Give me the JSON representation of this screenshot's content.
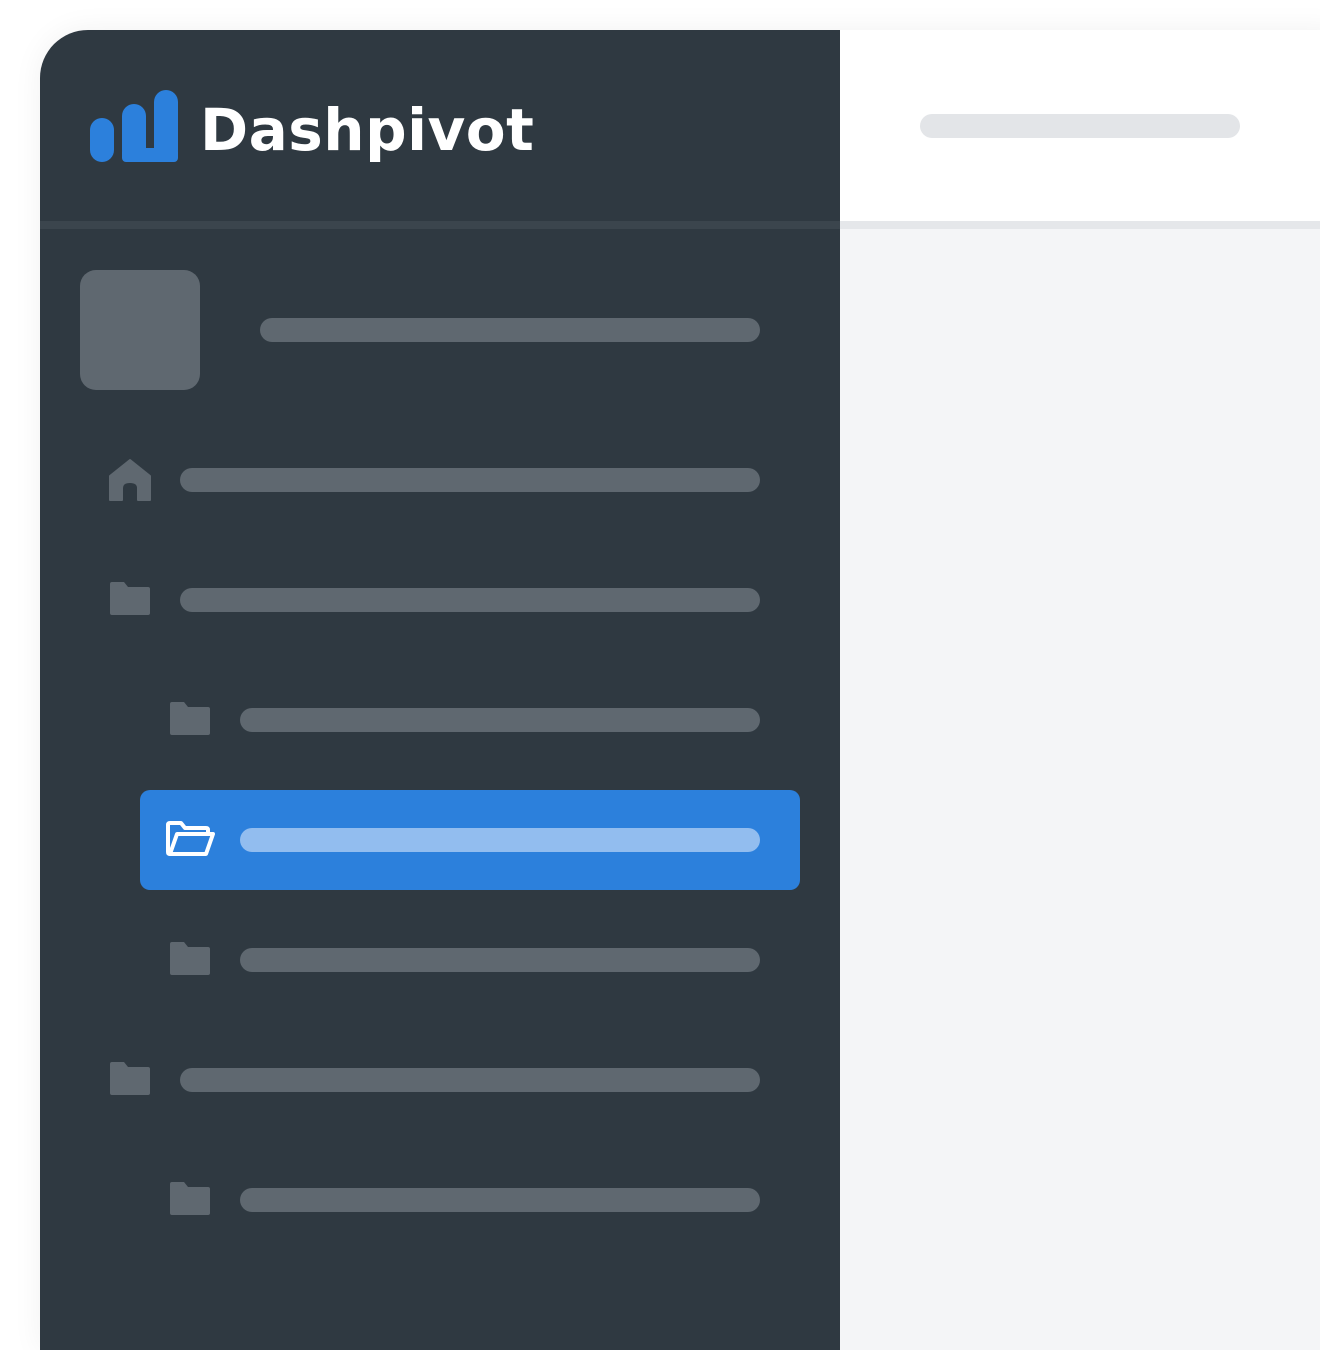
{
  "app": {
    "name": "Dashpivot",
    "brand_color": "#2c80dc",
    "sidebar_color": "#2f3941"
  },
  "sidebar": {
    "items": [
      {
        "icon": "home-icon",
        "level": 0,
        "active": false
      },
      {
        "icon": "folder-icon",
        "level": 0,
        "active": false
      },
      {
        "icon": "folder-icon",
        "level": 1,
        "active": false
      },
      {
        "icon": "folder-open-icon",
        "level": 1,
        "active": true
      },
      {
        "icon": "folder-icon",
        "level": 1,
        "active": false
      },
      {
        "icon": "folder-icon",
        "level": 0,
        "active": false
      },
      {
        "icon": "folder-icon",
        "level": 1,
        "active": false
      }
    ]
  }
}
